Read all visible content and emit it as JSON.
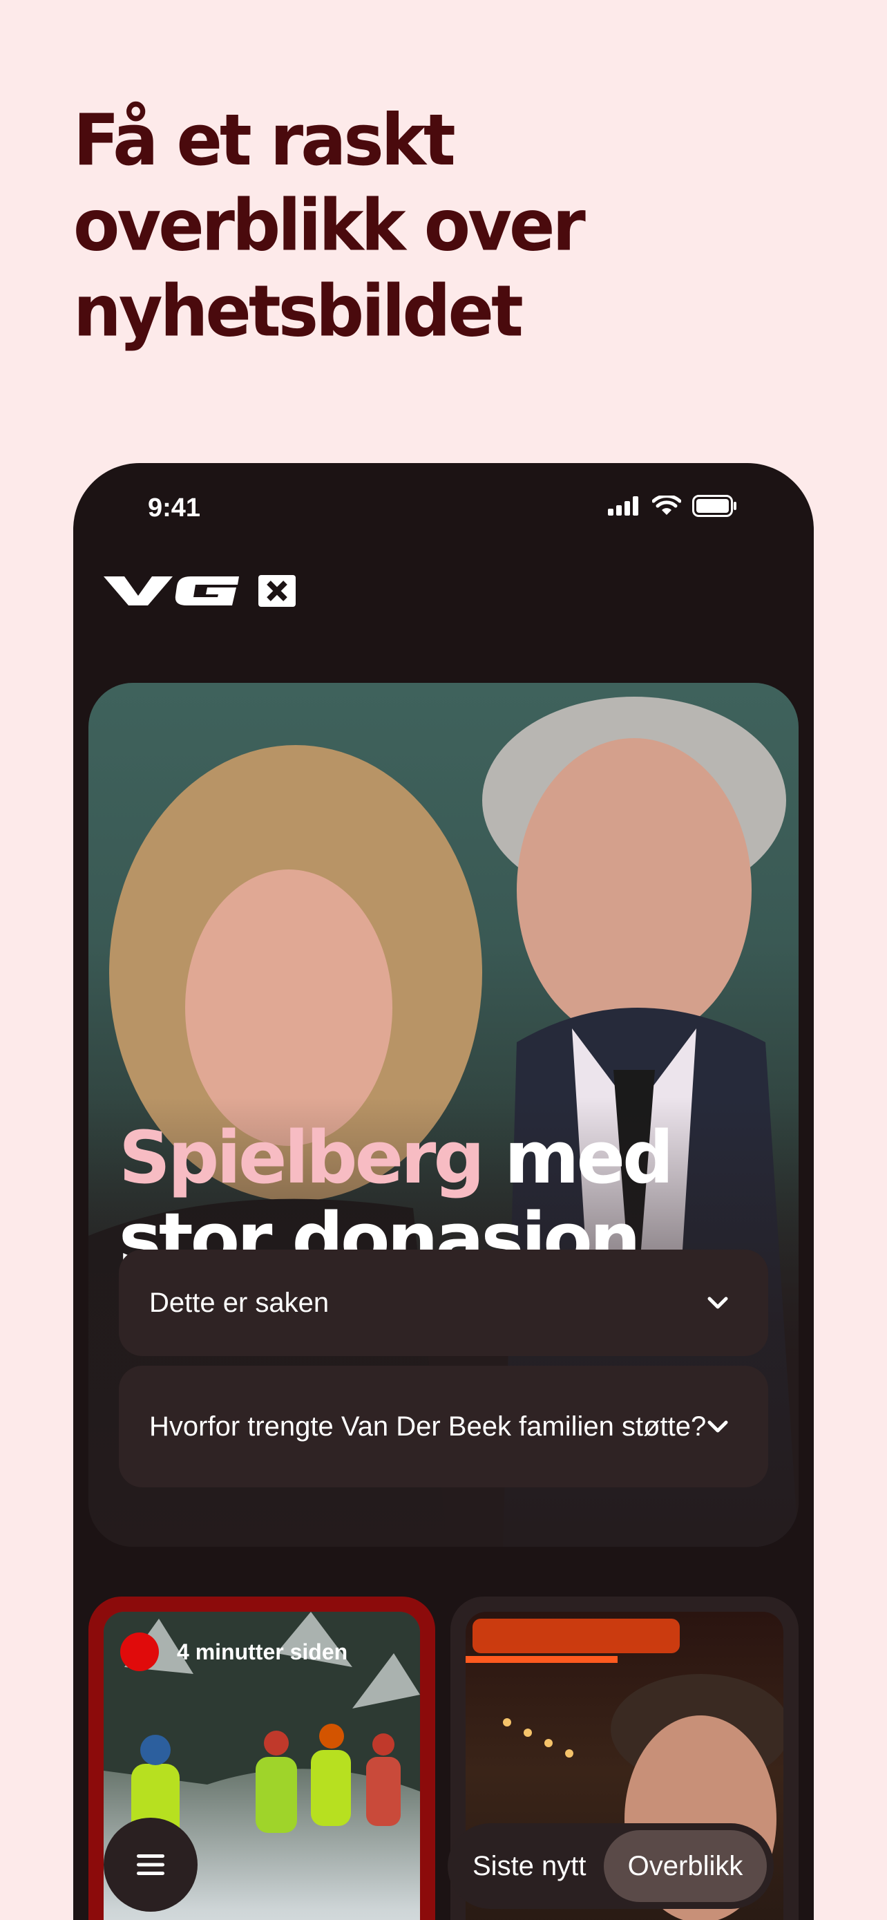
{
  "intro": {
    "headline": "Få et raskt overblikk over nyhetsbildet"
  },
  "phone": {
    "status": {
      "time": "9:41"
    },
    "logo": {
      "text": "VG",
      "badge": "X"
    },
    "hero": {
      "title_accent": "Spielberg",
      "title_rest": " med stor donasjon",
      "accordions": [
        {
          "label": "Dette er saken"
        },
        {
          "label": "Hvorfor trengte Van Der Beek familien støtte?"
        }
      ]
    },
    "cards": [
      {
        "live_label": "4 minutter siden"
      }
    ],
    "bottom_nav": {
      "options": [
        {
          "label": "Siste nytt",
          "selected": false
        },
        {
          "label": "Overblikk",
          "selected": true
        }
      ]
    }
  },
  "colors": {
    "background": "#fdeaea",
    "headline": "#4a0a0d",
    "phone": "#1c1314",
    "accent_pink": "#f7bcc3",
    "live_red": "#e00b0b",
    "live_border": "#8c0b0b"
  }
}
